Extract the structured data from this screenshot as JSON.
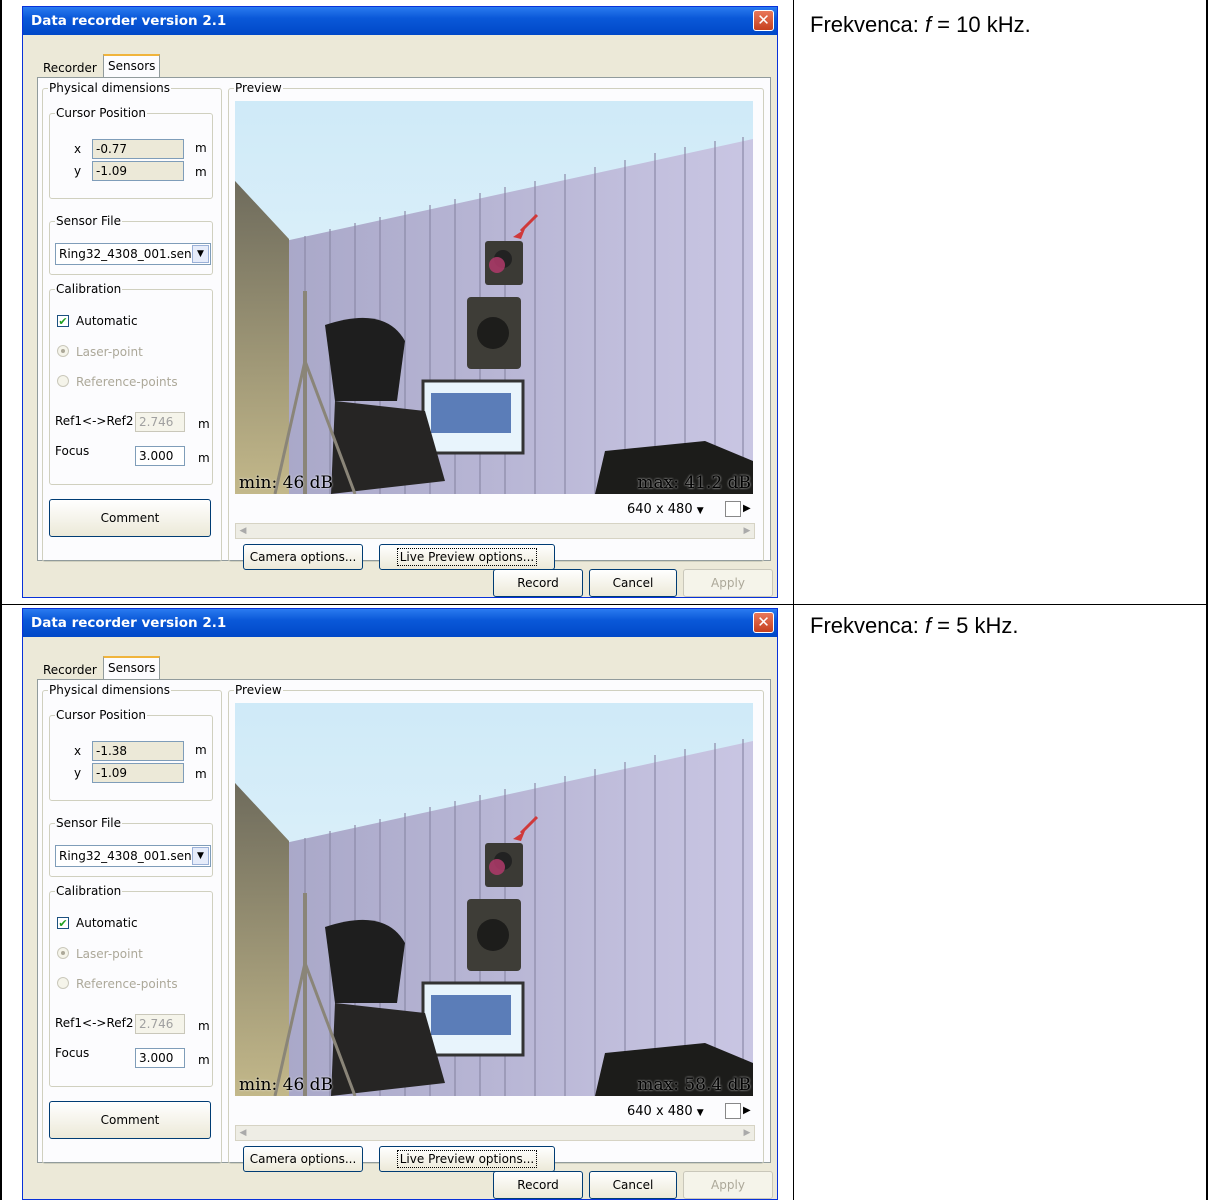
{
  "dialog": {
    "title": "Data recorder version 2.1",
    "close_glyph": "✕",
    "tabs": [
      "Recorder",
      "Sensors"
    ],
    "groups": {
      "physical": "Physical dimensions",
      "cursor": "Cursor Position",
      "sensor_file": "Sensor File",
      "calibration": "Calibration",
      "preview": "Preview"
    },
    "x_label": "x",
    "y_label": "y",
    "unit_m": "m",
    "sensor_file_value": "Ring32_4308_001.sen",
    "automatic_label": "Automatic",
    "automatic_checked": true,
    "laser_label": "Laser-point",
    "reference_label": "Reference-points",
    "ref_label": "Ref1<->Ref2",
    "ref_value": "2.746",
    "focus_label": "Focus",
    "focus_value": "3.000",
    "comment_button": "Comment",
    "resolution": "640 x 480",
    "camera_options_button": "Camera options...",
    "live_preview_button": "Live Preview options...",
    "record_button": "Record",
    "cancel_button": "Cancel",
    "apply_button": "Apply",
    "overlay_min": "min: 46  dB",
    "icons": [
      "close-icon",
      "dropdown-arrow-icon",
      "checkmark-icon",
      "copy-icon",
      "scroll-left-icon",
      "scroll-right-icon",
      "arrow-pointer-icon"
    ]
  },
  "panels": [
    {
      "caption_prefix": "Frekvenca: ",
      "caption_var": "f",
      "caption_suffix": " = 10 kHz.",
      "cursor_x": "-0.77",
      "cursor_y": "-1.09",
      "overlay_max": "max: 41.2 dB"
    },
    {
      "caption_prefix": "Frekvenca: ",
      "caption_var": "f",
      "caption_suffix": " = 5 kHz.",
      "cursor_x": "-1.38",
      "cursor_y": "-1.09",
      "overlay_max": "max: 58.4 dB"
    }
  ]
}
